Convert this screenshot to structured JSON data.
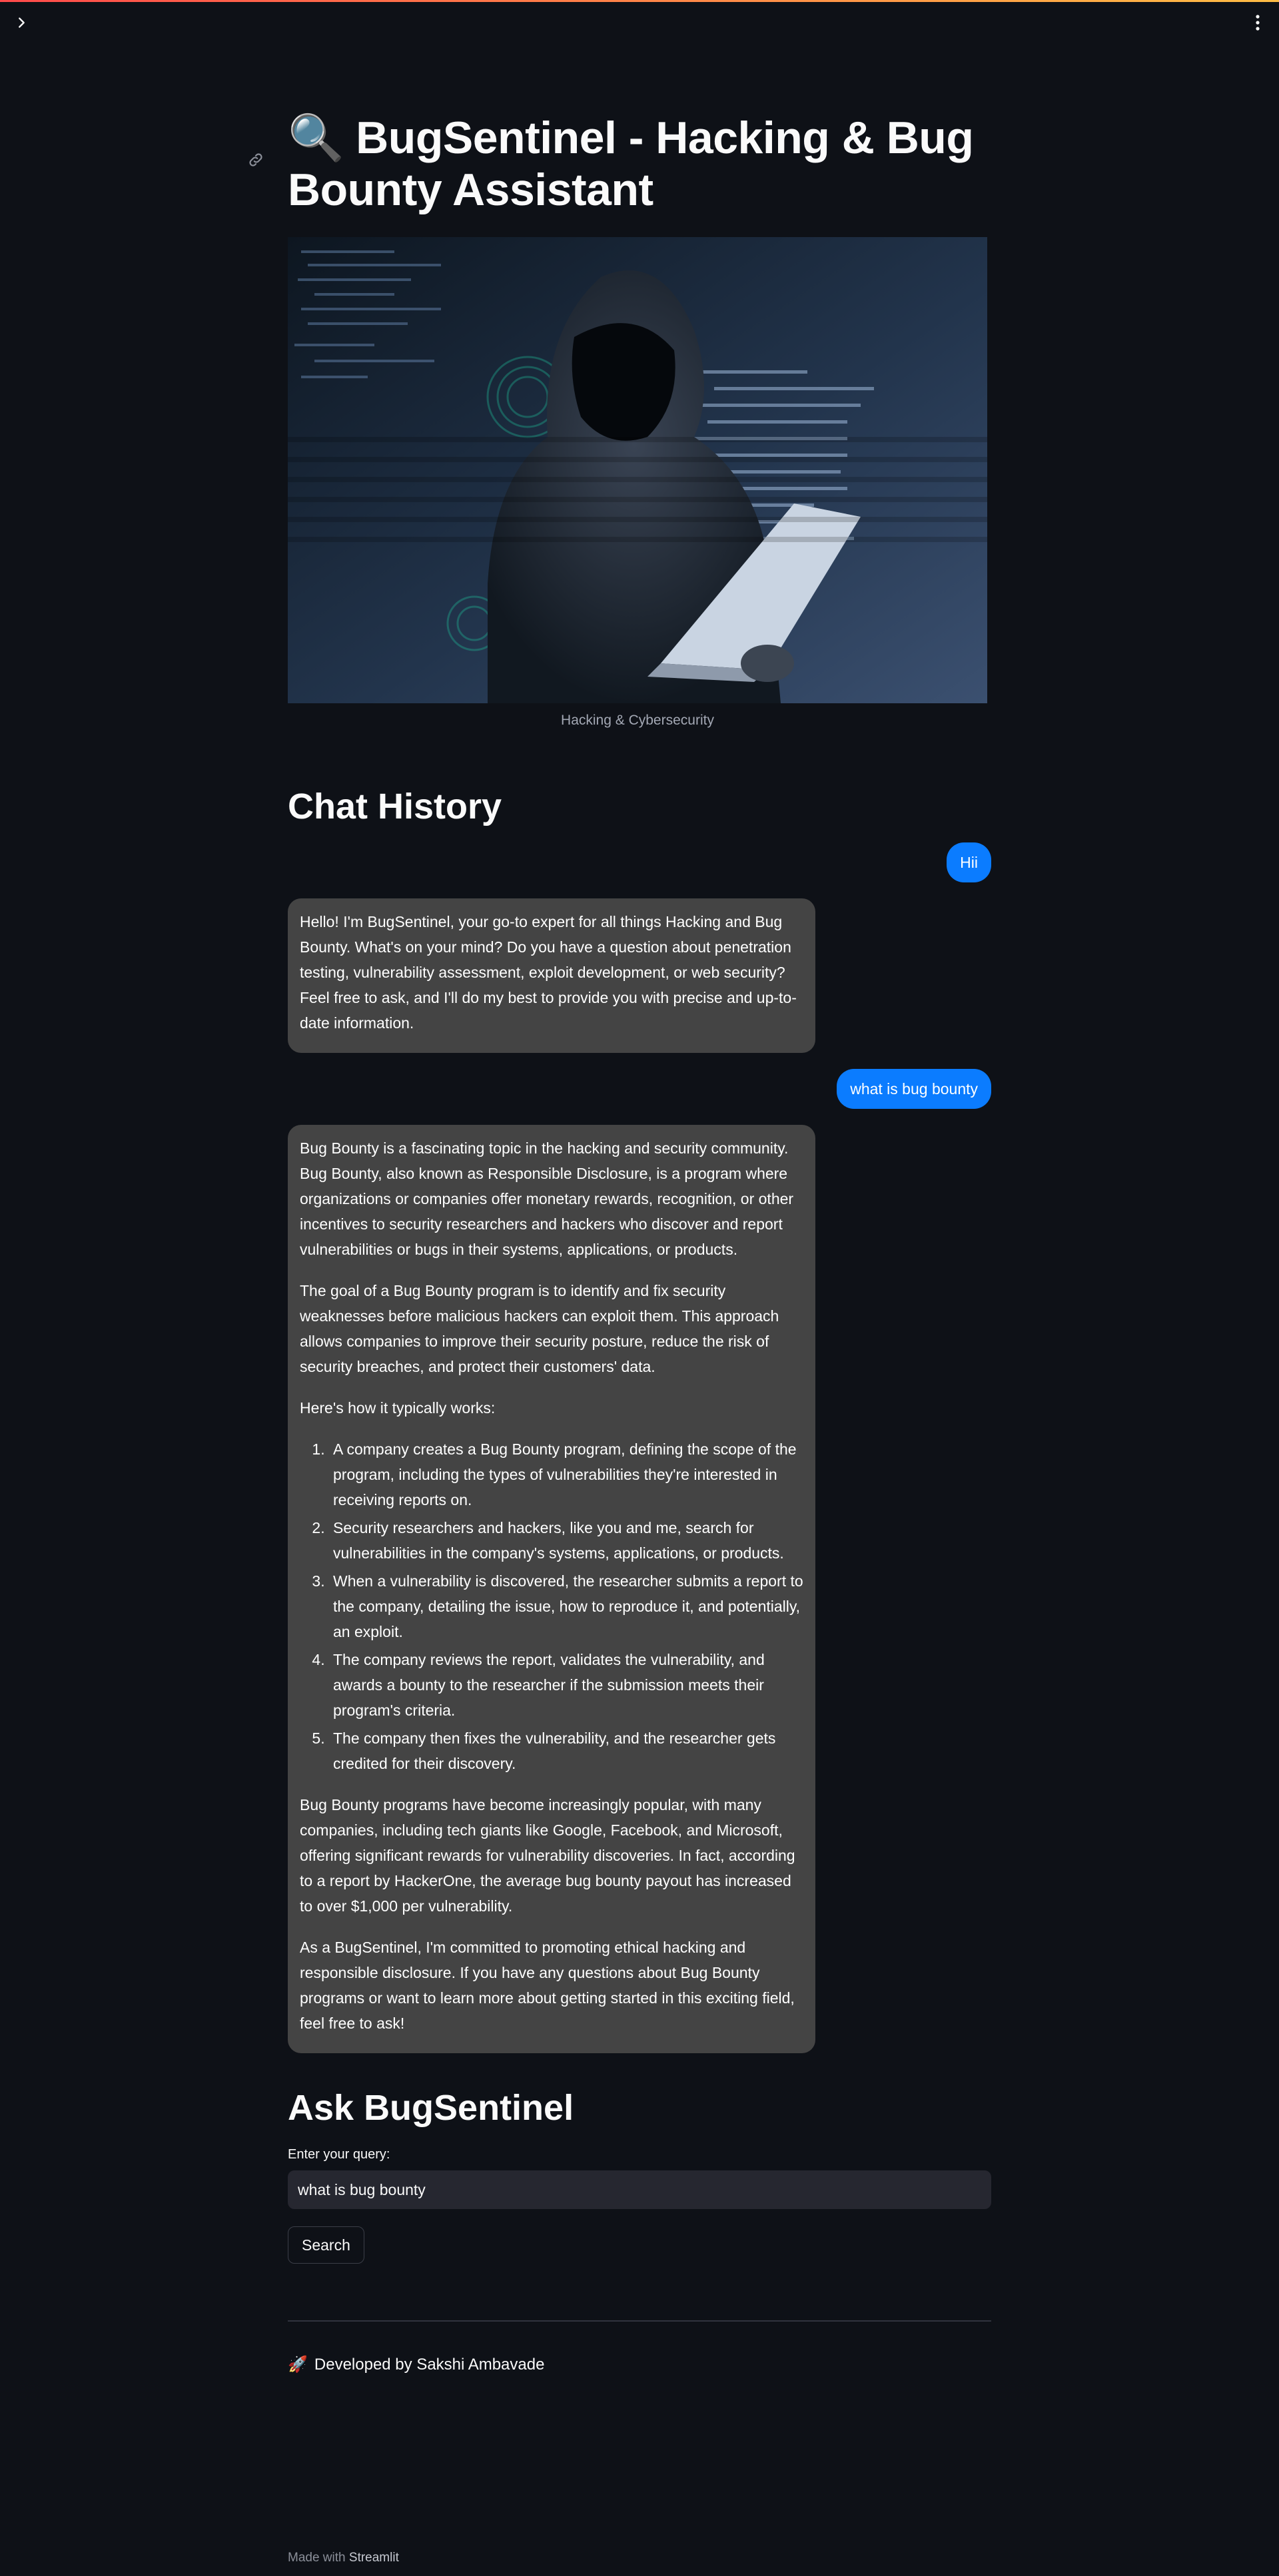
{
  "topbar": {
    "sidebar_toggle_icon": "chevron-right-icon",
    "menu_icon": "kebab-menu-icon",
    "accent_gradient": [
      "#ff4b4b",
      "#ffbd45"
    ]
  },
  "title": {
    "icon": "🔍",
    "text": "BugSentinel - Hacking & Bug Bounty Assistant"
  },
  "hero_image": {
    "caption": "Hacking & Cybersecurity"
  },
  "chat": {
    "heading": "Chat History",
    "user_color": "#0b7cff",
    "bot_color": "#444444",
    "messages": [
      {
        "role": "user",
        "text": "Hii"
      },
      {
        "role": "assistant",
        "paragraphs": [
          "Hello! I'm BugSentinel, your go-to expert for all things Hacking and Bug Bounty. What's on your mind? Do you have a question about penetration testing, vulnerability assessment, exploit development, or web security? Feel free to ask, and I'll do my best to provide you with precise and up-to-date information."
        ]
      },
      {
        "role": "user",
        "text": "what is bug bounty"
      },
      {
        "role": "assistant",
        "p1": "Bug Bounty is a fascinating topic in the hacking and security community. Bug Bounty, also known as Responsible Disclosure, is a program where organizations or companies offer monetary rewards, recognition, or other incentives to security researchers and hackers who discover and report vulnerabilities or bugs in their systems, applications, or products.",
        "p2": "The goal of a Bug Bounty program is to identify and fix security weaknesses before malicious hackers can exploit them. This approach allows companies to improve their security posture, reduce the risk of security breaches, and protect their customers' data.",
        "p3": "Here's how it typically works:",
        "steps": [
          "A company creates a Bug Bounty program, defining the scope of the program, including the types of vulnerabilities they're interested in receiving reports on.",
          "Security researchers and hackers, like you and me, search for vulnerabilities in the company's systems, applications, or products.",
          "When a vulnerability is discovered, the researcher submits a report to the company, detailing the issue, how to reproduce it, and potentially, an exploit.",
          "The company reviews the report, validates the vulnerability, and awards a bounty to the researcher if the submission meets their program's criteria.",
          "The company then fixes the vulnerability, and the researcher gets credited for their discovery."
        ],
        "p4": "Bug Bounty programs have become increasingly popular, with many companies, including tech giants like Google, Facebook, and Microsoft, offering significant rewards for vulnerability discoveries. In fact, according to a report by HackerOne, the average bug bounty payout has increased to over $1,000 per vulnerability.",
        "p5": "As a BugSentinel, I'm committed to promoting ethical hacking and responsible disclosure. If you have any questions about Bug Bounty programs or want to learn more about getting started in this exciting field, feel free to ask!"
      }
    ]
  },
  "ask": {
    "heading": "Ask BugSentinel",
    "input_label": "Enter your query:",
    "input_value": "what is bug bounty",
    "search_label": "Search"
  },
  "footer": {
    "icon": "🚀",
    "text": "Developed by Sakshi Ambavade"
  },
  "made_with": {
    "prefix": "Made with",
    "brand": "Streamlit"
  },
  "page_bg": "#0e1117"
}
